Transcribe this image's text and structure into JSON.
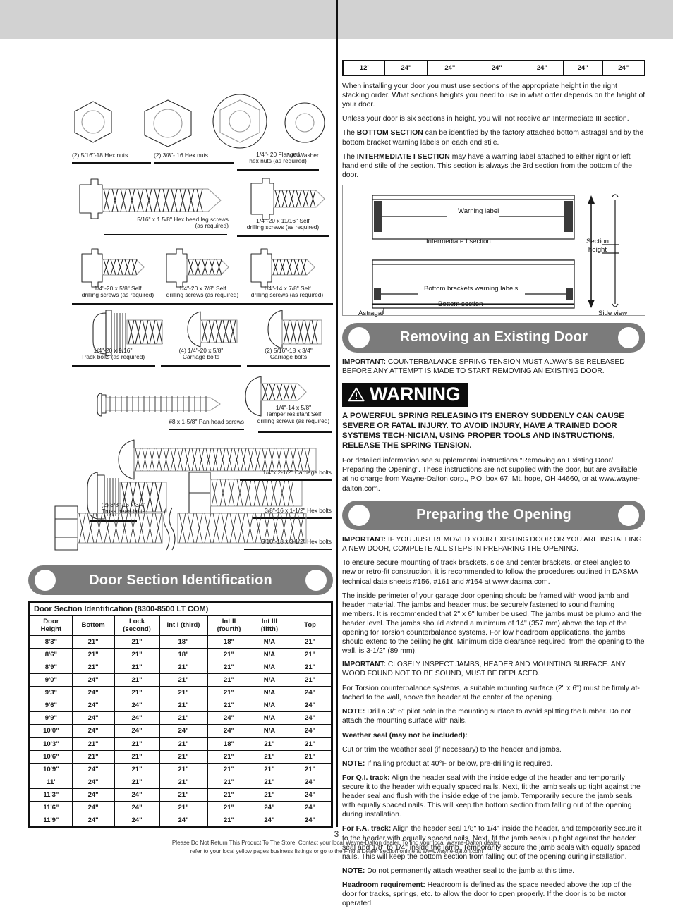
{
  "page": {
    "number": "3",
    "footer_line1": "Please Do Not Return This Product To The Store. Contact your local Wayne-Dalton dealer. To find your local Wayne-Dalton dealer,",
    "footer_line2": "refer to your local yellow pages business listings or go to the Find a Dealer section online at www.wayne-dalton.com"
  },
  "hardware": {
    "items": [
      {
        "label_line1": "(2) 5/16\"-18 Hex nuts",
        "label_line2": ""
      },
      {
        "label_line1": "(2) 3/8\"- 16 Hex nuts",
        "label_line2": ""
      },
      {
        "label_line1": "1/4\"- 20 Flanged",
        "label_line2": "hex nuts (as required)"
      },
      {
        "label_line1": "3/8\" Washer",
        "label_line2": ""
      },
      {
        "label_line1": "5/16\" x 1 5/8\" Hex head lag screws",
        "label_line2": "(as required)"
      },
      {
        "label_line1": "1/4\"-20 x 11/16\" Self",
        "label_line2": "drilling screws (as required)"
      },
      {
        "label_line1": "1/4\"-20 x 5/8\" Self",
        "label_line2": "drilling screws (as required)"
      },
      {
        "label_line1": "1/4\"-20 x 7/8\" Self",
        "label_line2": "drilling screws (as required)"
      },
      {
        "label_line1": "1/4\"-14 x 7/8\" Self",
        "label_line2": "drilling screws (as required)"
      },
      {
        "label_line1": "1/4\"-20 x 9/16\"",
        "label_line2": "Track bolts (as required)"
      },
      {
        "label_line1": "(4) 1/4\"-20 x 5/8\"",
        "label_line2": "Carriage bolts"
      },
      {
        "label_line1": "(2) 5/16\"-18 x 3/4\"",
        "label_line2": "Carriage bolts"
      },
      {
        "label_line1": "#8 x 1-5/8\" Pan head screws",
        "label_line2": ""
      },
      {
        "label_line1": "1/4\"-14 x 5/8\"",
        "label_line2": "Tamper resistant Self",
        "label_line3": "drilling screws (as required)"
      },
      {
        "label_line1": "1/4\"x 2-1/2\" Carriage bolts",
        "label_line2": ""
      },
      {
        "label_line1": "(2) 3/8\"-16 x 3/4\"",
        "label_line2": "Truss head bolts"
      },
      {
        "label_line1": "3/8\"-16 x 1-1/2\" Hex bolts",
        "label_line2": ""
      },
      {
        "label_line1": "5/16\"-18 x 3-1/2\" Hex bolts",
        "label_line2": ""
      }
    ]
  },
  "door_section_table": {
    "pill_title": "Door Section Identification",
    "caption": "Door Section Identification (8300-8500 LT COM)",
    "columns": [
      "Door Height",
      "Bottom",
      "Lock (second)",
      "Int I (third)",
      "Int II (fourth)",
      "Int III (fifth)",
      "Top"
    ],
    "columns_split": [
      [
        "Door",
        "Height"
      ],
      [
        "Bottom",
        ""
      ],
      [
        "Lock",
        "(second)"
      ],
      [
        "Int I (third)",
        ""
      ],
      [
        "Int II",
        "(fourth)"
      ],
      [
        "Int III",
        "(fifth)"
      ],
      [
        "Top",
        ""
      ]
    ],
    "rows": [
      [
        "8'3\"",
        "21\"",
        "21\"",
        "18\"",
        "18\"",
        "N/A",
        "21\""
      ],
      [
        "8'6\"",
        "21\"",
        "21\"",
        "18\"",
        "21\"",
        "N/A",
        "21\""
      ],
      [
        "8'9\"",
        "21\"",
        "21\"",
        "21\"",
        "21\"",
        "N/A",
        "21\""
      ],
      [
        "9'0\"",
        "24\"",
        "21\"",
        "21\"",
        "21\"",
        "N/A",
        "21\""
      ],
      [
        "9'3\"",
        "24\"",
        "21\"",
        "21\"",
        "21\"",
        "N/A",
        "24\""
      ],
      [
        "9'6\"",
        "24\"",
        "24\"",
        "21\"",
        "21\"",
        "N/A",
        "24\""
      ],
      [
        "9'9\"",
        "24\"",
        "24\"",
        "21\"",
        "24\"",
        "N/A",
        "24\""
      ],
      [
        "10'0\"",
        "24\"",
        "24\"",
        "24\"",
        "24\"",
        "N/A",
        "24\""
      ],
      [
        "10'3\"",
        "21\"",
        "21\"",
        "21\"",
        "18\"",
        "21\"",
        "21\""
      ],
      [
        "10'6\"",
        "21\"",
        "21\"",
        "21\"",
        "21\"",
        "21\"",
        "21\""
      ],
      [
        "10'9\"",
        "24\"",
        "21\"",
        "21\"",
        "21\"",
        "21\"",
        "21\""
      ],
      [
        "11'",
        "24\"",
        "21\"",
        "21\"",
        "21\"",
        "21\"",
        "24\""
      ],
      [
        "11'3\"",
        "24\"",
        "24\"",
        "21\"",
        "21\"",
        "21\"",
        "24\""
      ],
      [
        "11'6\"",
        "24\"",
        "24\"",
        "21\"",
        "21\"",
        "24\"",
        "24\""
      ],
      [
        "11'9\"",
        "24\"",
        "24\"",
        "24\"",
        "21\"",
        "24\"",
        "24\""
      ]
    ],
    "thick_divider_after_row_index": 7,
    "continuation_row": [
      "12'",
      "24\"",
      "24\"",
      "24\"",
      "24\"",
      "24\"",
      "24\""
    ]
  },
  "right_column": {
    "intro_paragraphs": [
      "When installing your door you must use sections of the appropriate height in the right stacking order. What sections heights you need to use in what order depends on the height of your door.",
      "Unless your door is six sections in height, you will not receive an Intermediate III section."
    ],
    "bottom_section_lead": "The ",
    "bottom_section_bold": "BOTTOM SECTION",
    "bottom_section_rest": " can be identified by the factory attached bottom astragal and by the bottom bracket warning labels on each end stile.",
    "intermediate_lead": "The ",
    "intermediate_bold": "INTERMEDIATE I SECTION",
    "intermediate_rest": " may have a warning label attached to either right or left hand end stile of the section. This section is always the 3rd section from the bottom of the door.",
    "diagram": {
      "warning_label": "Warning label",
      "intermediate_caption": "Intermediate I section",
      "bottom_brackets_label": "Bottom brackets warning labels",
      "bottom_caption": "Bottom section",
      "astragal": "Astragal",
      "section_height_line1": "Section",
      "section_height_line2": "height",
      "side_view": "Side view"
    }
  },
  "removing_door": {
    "pill_title": "Removing an Existing Door",
    "important_lead": "IMPORTANT:",
    "important_text": " COUNTERBALANCE SPRING TENSION MUST ALWAYS BE RELEASED BEFORE ANY ATTEMPT IS MADE TO START REMOVING AN EXISTING DOOR.",
    "warning_word": "WARNING",
    "warning_body": "A POWERFUL SPRING RELEASING ITS ENERGY SUDDENLY CAN CAUSE SEVERE OR FATAL INJURY. TO AVOID INJURY, HAVE A TRAINED DOOR SYSTEMS TECH-NICIAN, USING PROPER TOOLS AND INSTRUCTIONS, RELEASE THE SPRING TENSION.",
    "detail_text": "For detailed information see supplemental instructions “Removing an Existing Door/ Preparing the Opening”. These instructions are not supplied with the door, but are available at no charge from Wayne-Dalton corp., P.O. box 67, Mt. hope, OH 44660, or at www.wayne-dalton.com."
  },
  "preparing_opening": {
    "pill_title": "Preparing the Opening",
    "blocks": [
      {
        "lead": "IMPORTANT:",
        "text": " IF YOU JUST REMOVED YOUR EXISTING DOOR OR YOU ARE INSTALLING A NEW DOOR, COMPLETE ALL STEPS IN PREPARING THE OPENING.",
        "caps": true
      },
      {
        "lead": "",
        "text": "To ensure secure mounting of track brackets, side and center brackets, or steel angles to new or retro-fit construction, it is recommended to follow the procedures outlined in DASMA technical data sheets #156, #161 and #164 at www.dasma.com.",
        "caps": false
      },
      {
        "lead": "",
        "text": "The inside perimeter of your garage door opening should be framed with wood jamb and header material. The jambs and header must be securely fastened to sound framing members. It is recommended that 2\" x 6\" lumber be used. The jambs must be plumb and the header level. The jambs should extend a minimum of 14\" (357 mm) above the top of the opening for Torsion counterbalance systems. For low headroom applications, the jambs should extend to the ceiling height. Minimum side clearance required, from the opening to the wall, is 3-1/2\" (89 mm).",
        "caps": false
      },
      {
        "lead": "IMPORTANT:",
        "text": " CLOSELY INSPECT JAMBS, HEADER AND MOUNTING SURFACE. ANY WOOD FOUND NOT TO BE SOUND, MUST BE REPLACED.",
        "caps": true
      },
      {
        "lead": "",
        "text": "For Torsion counterbalance systems, a suitable mounting surface (2\" x 6\") must be firmly at-tached to the wall, above the header at the center of the opening.",
        "caps": false
      },
      {
        "lead": "NOTE:",
        "text": " Drill a 3/16\" pilot hole in the mounting surface to avoid splitting the lumber. Do not attach the mounting surface with nails.",
        "caps": false
      },
      {
        "lead": "Weather seal (may not be included):",
        "text": "",
        "caps": false
      },
      {
        "lead": "",
        "text": "Cut or trim the weather seal (if necessary) to the header and jambs.",
        "caps": false
      },
      {
        "lead": "NOTE:",
        "text": " If nailing product at 40°F or below, pre-drilling is required.",
        "caps": false
      },
      {
        "lead": "For Q.I. track:",
        "text": " Align the header seal with the inside edge of the header and temporarily secure it to the header with equally spaced nails. Next, fit the jamb seals up tight against the header seal and flush with the inside edge of the jamb. Temporarily secure the jamb seals with equally spaced nails. This will keep the bottom section from falling out of the opening during installation.",
        "caps": false
      },
      {
        "lead": "For F.A. track:",
        "text": " Align the header seal 1/8\" to 1/4\" inside the header, and temporarily secure it to the header with equally spaced nails. Next, fit the jamb seals up tight against the header seal and 1/8\" to 1/4\" inside the jamb. Temporarily secure the jamb seals with equally spaced nails. This will keep the bottom section from falling out of the opening during installation.",
        "caps": false
      },
      {
        "lead": "NOTE:",
        "text": " Do not permanently attach weather seal to the jamb at this time.",
        "caps": false
      },
      {
        "lead": "Headroom requirement:",
        "text": " Headroom is defined as the space needed above the top of the door for tracks, springs, etc. to allow the door to open properly. If the door is to be motor operated,",
        "caps": false
      }
    ]
  },
  "colors": {
    "band_gray": "#d2d2d2",
    "pill_gray": "#7b7b7b",
    "warning_black": "#0d0d0d",
    "rule_black": "#111111"
  }
}
